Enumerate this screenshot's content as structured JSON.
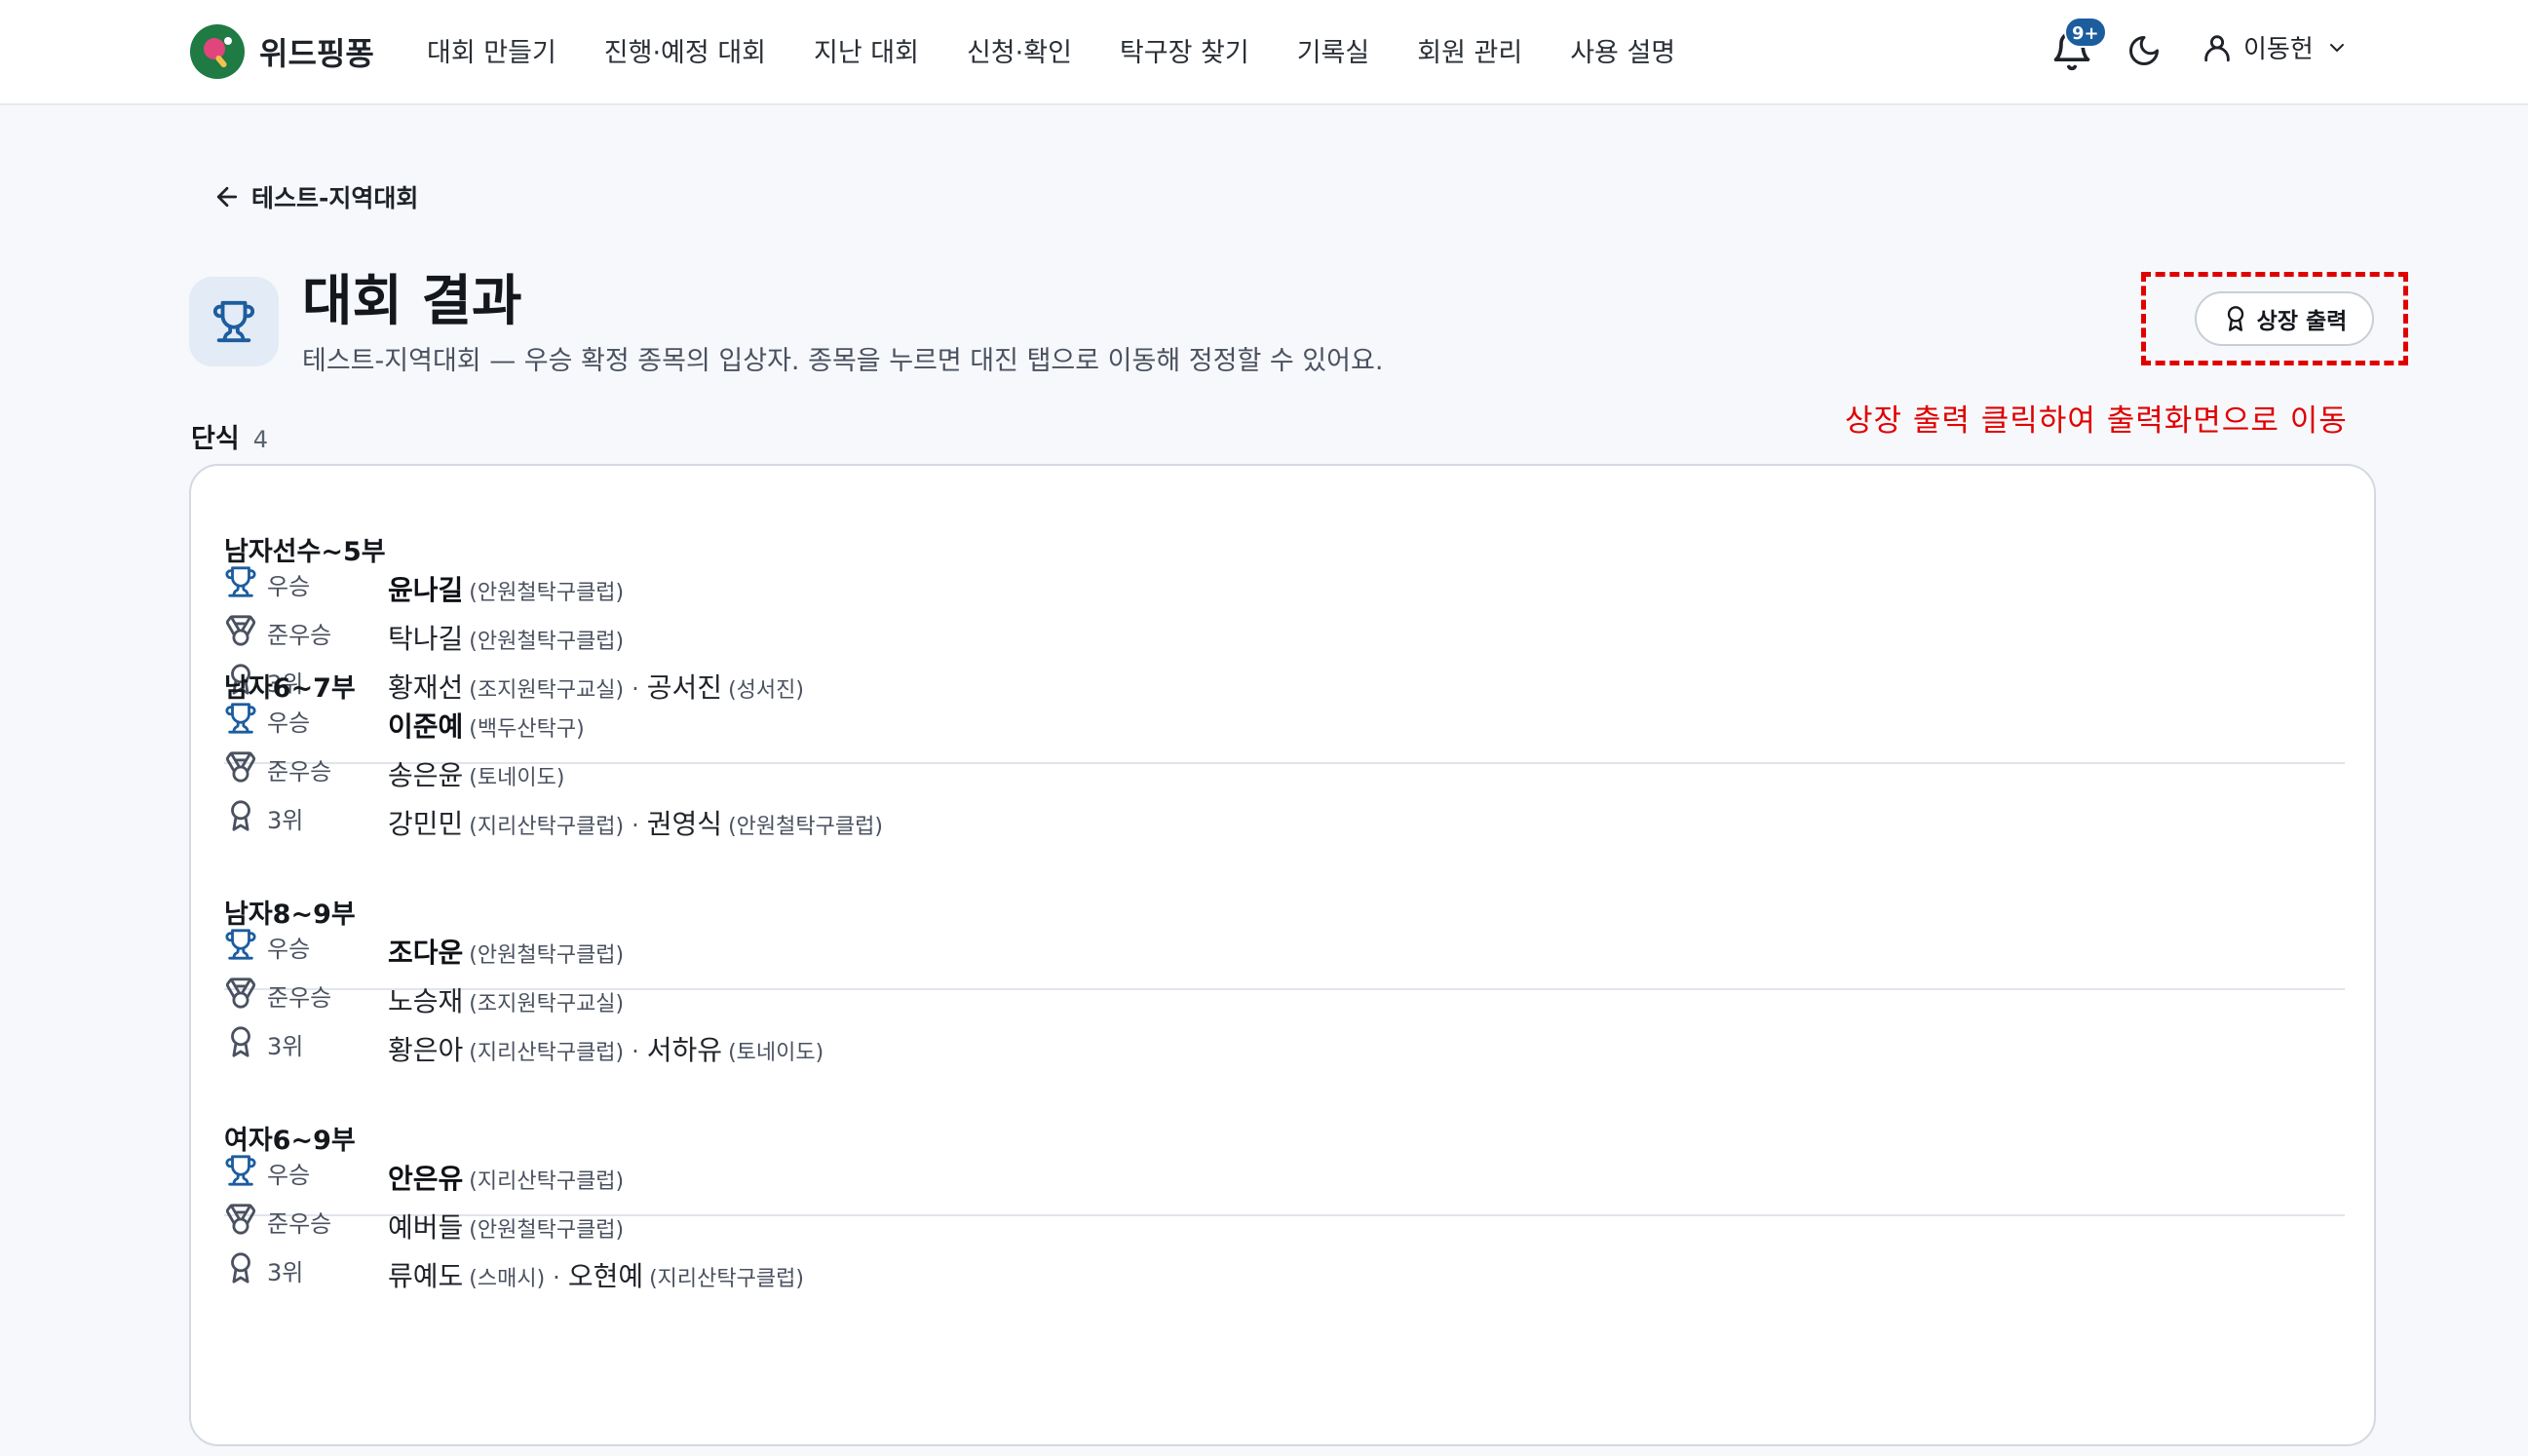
{
  "header": {
    "logo_text": "위드핑퐁",
    "nav": [
      "대회 만들기",
      "진행·예정 대회",
      "지난 대회",
      "신청·확인",
      "탁구장 찾기",
      "기록실",
      "회원 관리",
      "사용 설명"
    ],
    "notification_badge": "9+",
    "user_name": "이동헌"
  },
  "back_link": "테스트-지역대회",
  "page": {
    "title": "대회 결과",
    "subtitle": "테스트-지역대회 — 우승 확정 종목의 입상자. 종목을 누르면 대진 탭으로 이동해 정정할 수 있어요.",
    "award_button": "상장 출력",
    "annotation": "상장 출력 클릭하여 출력화면으로 이동"
  },
  "section": {
    "title": "단식",
    "count": "4"
  },
  "events": [
    {
      "title": "남자선수~5부",
      "winner": {
        "rank": "우승",
        "name": "윤나길",
        "club": "(안원철탁구클럽)"
      },
      "runner_up": {
        "rank": "준우승",
        "name": "탁나길",
        "club": "(안원철탁구클럽)"
      },
      "third": {
        "rank": "3위",
        "name1": "황재선",
        "club1": "(조지원탁구교실)",
        "sep": "·",
        "name2": "공서진",
        "club2": "(성서진)"
      }
    },
    {
      "title": "남자6~7부",
      "winner": {
        "rank": "우승",
        "name": "이준예",
        "club": "(백두산탁구)"
      },
      "runner_up": {
        "rank": "준우승",
        "name": "송은윤",
        "club": "(토네이도)"
      },
      "third": {
        "rank": "3위",
        "name1": "강민민",
        "club1": "(지리산탁구클럽)",
        "sep": "·",
        "name2": "권영식",
        "club2": "(안원철탁구클럽)"
      }
    },
    {
      "title": "남자8~9부",
      "winner": {
        "rank": "우승",
        "name": "조다운",
        "club": "(안원철탁구클럽)"
      },
      "runner_up": {
        "rank": "준우승",
        "name": "노승재",
        "club": "(조지원탁구교실)"
      },
      "third": {
        "rank": "3위",
        "name1": "황은아",
        "club1": "(지리산탁구클럽)",
        "sep": "·",
        "name2": "서하유",
        "club2": "(토네이도)"
      }
    },
    {
      "title": "여자6~9부",
      "winner": {
        "rank": "우승",
        "name": "안은유",
        "club": "(지리산탁구클럽)"
      },
      "runner_up": {
        "rank": "준우승",
        "name": "예버들",
        "club": "(안원철탁구클럽)"
      },
      "third": {
        "rank": "3위",
        "name1": "류예도",
        "club1": "(스매시)",
        "sep": "·",
        "name2": "오현예",
        "club2": "(지리산탁구클럽)"
      }
    }
  ],
  "colors": {
    "accent": "#1c5d9e",
    "annotation": "#e00000",
    "logo_green": "#1f7a44",
    "logo_pink": "#e0457b"
  },
  "icons": {
    "winner": "trophy-icon",
    "runner_up": "medal-icon",
    "third": "award-ribbon-icon"
  }
}
